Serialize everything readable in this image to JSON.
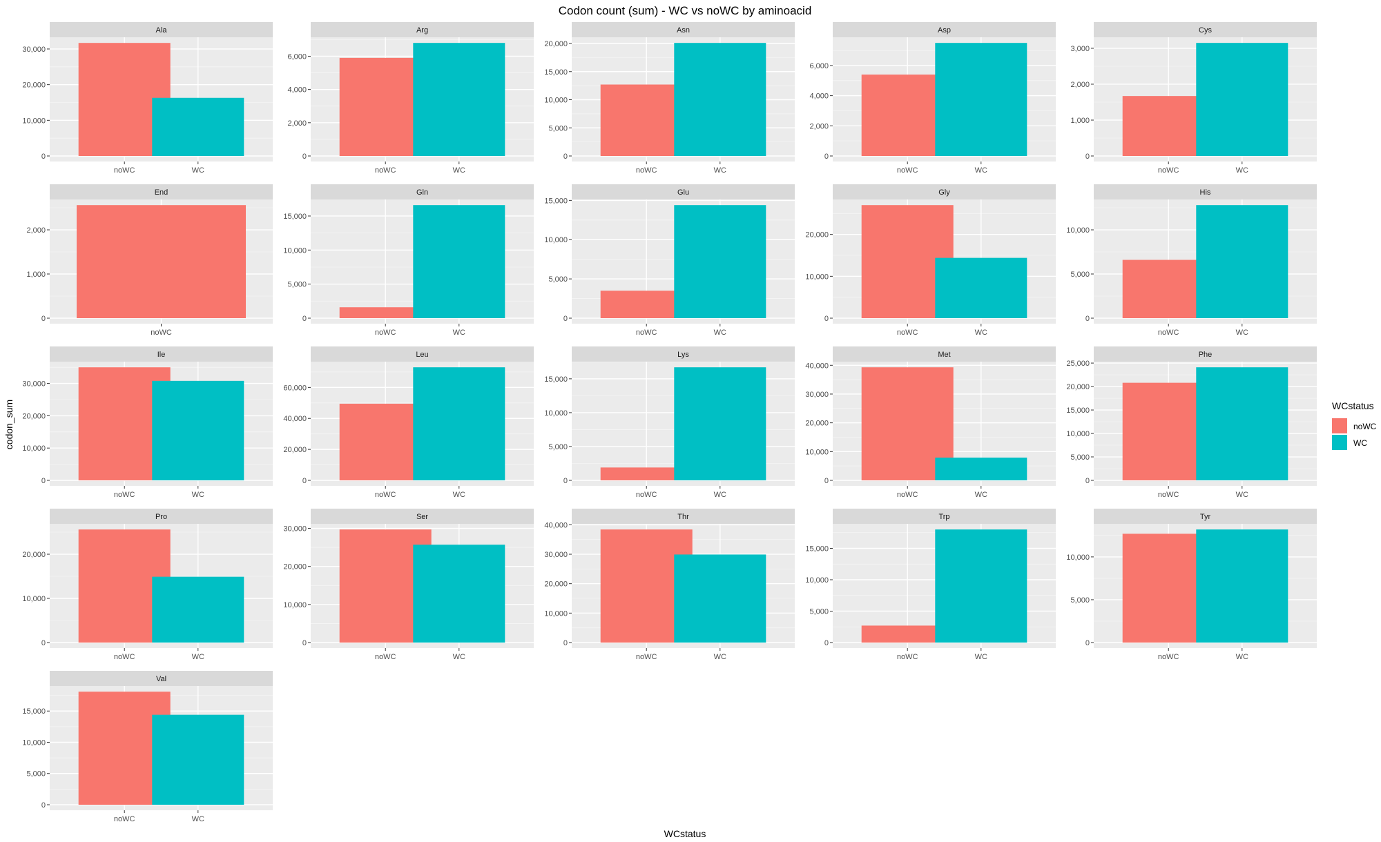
{
  "chart_data": {
    "type": "bar",
    "layout": "faceted",
    "title": "Codon count (sum) -  WC vs noWC by aminoacid",
    "xlabel": "WCstatus",
    "ylabel": "codon_sum",
    "legend": {
      "title": "WCstatus",
      "position": "right",
      "entries": [
        {
          "name": "noWC",
          "color": "#F8766D"
        },
        {
          "name": "WC",
          "color": "#00BFC4"
        }
      ]
    },
    "grid": true,
    "colors": {
      "noWC": "#F8766D",
      "WC": "#00BFC4",
      "panel": "#EBEBEB",
      "strip": "#D9D9D9"
    },
    "facets": [
      {
        "name": "Ala",
        "categories": [
          "noWC",
          "WC"
        ],
        "values": [
          31700,
          16300
        ],
        "yticks": [
          0,
          10000,
          20000,
          30000
        ],
        "tick_labels": [
          "0",
          "10,000",
          "20,000",
          "30,000"
        ],
        "ylim": [
          0,
          33285
        ]
      },
      {
        "name": "Arg",
        "categories": [
          "noWC",
          "WC"
        ],
        "values": [
          5900,
          6800
        ],
        "yticks": [
          0,
          2000,
          4000,
          6000
        ],
        "tick_labels": [
          "0",
          "2,000",
          "4,000",
          "6,000"
        ],
        "ylim": [
          0,
          7140
        ]
      },
      {
        "name": "Asn",
        "categories": [
          "noWC",
          "WC"
        ],
        "values": [
          12700,
          20100
        ],
        "yticks": [
          0,
          5000,
          10000,
          15000,
          20000
        ],
        "tick_labels": [
          "0",
          "5,000",
          "10,000",
          "15,000",
          "20,000"
        ],
        "ylim": [
          0,
          21105
        ]
      },
      {
        "name": "Asp",
        "categories": [
          "noWC",
          "WC"
        ],
        "values": [
          5400,
          7500
        ],
        "yticks": [
          0,
          2000,
          4000,
          6000
        ],
        "tick_labels": [
          "0",
          "2,000",
          "4,000",
          "6,000"
        ],
        "ylim": [
          0,
          7875
        ]
      },
      {
        "name": "Cys",
        "categories": [
          "noWC",
          "WC"
        ],
        "values": [
          1670,
          3150
        ],
        "yticks": [
          0,
          1000,
          2000,
          3000
        ],
        "tick_labels": [
          "0",
          "1,000",
          "2,000",
          "3,000"
        ],
        "ylim": [
          0,
          3307
        ]
      },
      {
        "name": "End",
        "categories": [
          "noWC"
        ],
        "values": [
          2560
        ],
        "yticks": [
          0,
          1000,
          2000
        ],
        "tick_labels": [
          "0",
          "1,000",
          "2,000"
        ],
        "ylim": [
          0,
          2688
        ]
      },
      {
        "name": "Gln",
        "categories": [
          "noWC",
          "WC"
        ],
        "values": [
          1600,
          16600
        ],
        "yticks": [
          0,
          5000,
          10000,
          15000
        ],
        "tick_labels": [
          "0",
          "5,000",
          "10,000",
          "15,000"
        ],
        "ylim": [
          0,
          17430
        ]
      },
      {
        "name": "Glu",
        "categories": [
          "noWC",
          "WC"
        ],
        "values": [
          3500,
          14400
        ],
        "yticks": [
          0,
          5000,
          10000,
          15000
        ],
        "tick_labels": [
          "0",
          "5,000",
          "10,000",
          "15,000"
        ],
        "ylim": [
          0,
          15120
        ]
      },
      {
        "name": "Gly",
        "categories": [
          "noWC",
          "WC"
        ],
        "values": [
          27000,
          14400
        ],
        "yticks": [
          0,
          10000,
          20000
        ],
        "tick_labels": [
          "0",
          "10,000",
          "20,000"
        ],
        "ylim": [
          0,
          28350
        ]
      },
      {
        "name": "His",
        "categories": [
          "noWC",
          "WC"
        ],
        "values": [
          6600,
          12800
        ],
        "yticks": [
          0,
          5000,
          10000
        ],
        "tick_labels": [
          "0",
          "5,000",
          "10,000"
        ],
        "ylim": [
          0,
          13440
        ]
      },
      {
        "name": "Ile",
        "categories": [
          "noWC",
          "WC"
        ],
        "values": [
          35000,
          30800
        ],
        "yticks": [
          0,
          10000,
          20000,
          30000
        ],
        "tick_labels": [
          "0",
          "10,000",
          "20,000",
          "30,000"
        ],
        "ylim": [
          0,
          36750
        ]
      },
      {
        "name": "Leu",
        "categories": [
          "noWC",
          "WC"
        ],
        "values": [
          49500,
          73000
        ],
        "yticks": [
          0,
          20000,
          40000,
          60000
        ],
        "tick_labels": [
          "0",
          "20,000",
          "40,000",
          "60,000"
        ],
        "ylim": [
          0,
          76650
        ]
      },
      {
        "name": "Lys",
        "categories": [
          "noWC",
          "WC"
        ],
        "values": [
          1900,
          16700
        ],
        "yticks": [
          0,
          5000,
          10000,
          15000
        ],
        "tick_labels": [
          "0",
          "5,000",
          "10,000",
          "15,000"
        ],
        "ylim": [
          0,
          17535
        ]
      },
      {
        "name": "Met",
        "categories": [
          "noWC",
          "WC"
        ],
        "values": [
          39300,
          7900
        ],
        "yticks": [
          0,
          10000,
          20000,
          30000,
          40000
        ],
        "tick_labels": [
          "0",
          "10,000",
          "20,000",
          "30,000",
          "40,000"
        ],
        "ylim": [
          0,
          41265
        ]
      },
      {
        "name": "Phe",
        "categories": [
          "noWC",
          "WC"
        ],
        "values": [
          20800,
          24100
        ],
        "yticks": [
          0,
          5000,
          10000,
          15000,
          20000,
          25000
        ],
        "tick_labels": [
          "0",
          "5,000",
          "10,000",
          "15,000",
          "20,000",
          "25,000"
        ],
        "ylim": [
          0,
          25305
        ]
      },
      {
        "name": "Pro",
        "categories": [
          "noWC",
          "WC"
        ],
        "values": [
          25600,
          14900
        ],
        "yticks": [
          0,
          10000,
          20000
        ],
        "tick_labels": [
          "0",
          "10,000",
          "20,000"
        ],
        "ylim": [
          0,
          26880
        ]
      },
      {
        "name": "Ser",
        "categories": [
          "noWC",
          "WC"
        ],
        "values": [
          29700,
          25700
        ],
        "yticks": [
          0,
          10000,
          20000,
          30000
        ],
        "tick_labels": [
          "0",
          "10,000",
          "20,000",
          "30,000"
        ],
        "ylim": [
          0,
          31185
        ]
      },
      {
        "name": "Thr",
        "categories": [
          "noWC",
          "WC"
        ],
        "values": [
          38400,
          29900
        ],
        "yticks": [
          0,
          10000,
          20000,
          30000,
          40000
        ],
        "tick_labels": [
          "0",
          "10,000",
          "20,000",
          "30,000",
          "40,000"
        ],
        "ylim": [
          0,
          40320
        ]
      },
      {
        "name": "Trp",
        "categories": [
          "noWC",
          "WC"
        ],
        "values": [
          2700,
          18000
        ],
        "yticks": [
          0,
          5000,
          10000,
          15000
        ],
        "tick_labels": [
          "0",
          "5,000",
          "10,000",
          "15,000"
        ],
        "ylim": [
          0,
          18900
        ]
      },
      {
        "name": "Tyr",
        "categories": [
          "noWC",
          "WC"
        ],
        "values": [
          12700,
          13200
        ],
        "yticks": [
          0,
          5000,
          10000
        ],
        "tick_labels": [
          "0",
          "5,000",
          "10,000"
        ],
        "ylim": [
          0,
          13860
        ]
      },
      {
        "name": "Val",
        "categories": [
          "noWC",
          "WC"
        ],
        "values": [
          18100,
          14400
        ],
        "yticks": [
          0,
          5000,
          10000,
          15000
        ],
        "tick_labels": [
          "0",
          "5,000",
          "10,000",
          "15,000"
        ],
        "ylim": [
          0,
          19005
        ]
      }
    ]
  }
}
